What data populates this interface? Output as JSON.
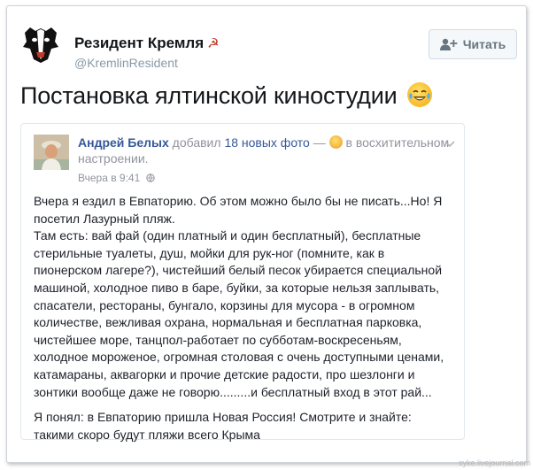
{
  "tweet": {
    "author_name": "Резидент Кремля",
    "author_symbol": "☭",
    "author_handle": "@KremlinResident",
    "follow_label": "Читать",
    "text": "Постановка ялтинской киностудии",
    "emoji_icon": "tears-of-joy-icon"
  },
  "facebook_post": {
    "poster_name": "Андрей Белых",
    "action_text": " добавил ",
    "photos_link": "18 новых фото",
    "dash": " — ",
    "feeling_text": " в восхитительном настроении.",
    "timestamp": "Вчера в 9:41",
    "paragraphs": [
      "Вчера я ездил в Евпаторию. Об этом можно было бы не писать...Но! Я посетил Лазурный пляж.",
      "Там есть: вай фай (один платный и один бесплатный), бесплатные стерильные туалеты, душ, мойки для рук-ног (помните, как в пионерском лагере?), чистейший белый песок убирается специальной машиной, холодное пиво в баре, буйки, за которые нельзя заплывать, спасатели, рестораны, бунгало, корзины для мусора - в огромном количестве, вежливая охрана, нормальная и бесплатная парковка, чистейшее море, танцпол-работает по субботам-воскресеньям, холодное мороженое, огромная столовая с очень доступными ценами, катамараны, аквагорки и прочие детские радости, про шезлонги и зонтики вообще даже не говорю.........и бесплатный вход в этот рай...",
      "Я понял: в Евпаторию пришла Новая Россия! Смотрите и знайте: такими скоро будут пляжи всего Крыма"
    ]
  },
  "watermark": "syke.livejournal.com"
}
